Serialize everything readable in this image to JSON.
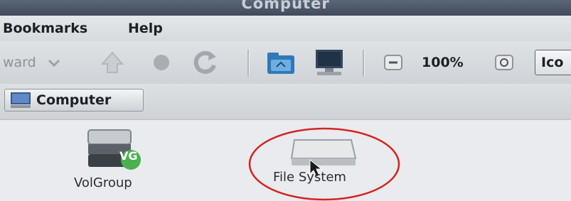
{
  "window": {
    "title": "Computer"
  },
  "menu": {
    "bookmarks": "Bookmarks",
    "help": "Help"
  },
  "toolbar": {
    "forward_label": "ward",
    "zoom_level": "100%",
    "view_mode": "Ico"
  },
  "location": {
    "crumb": "Computer"
  },
  "content": {
    "items": [
      {
        "label": "VolGroup",
        "badge": "VG"
      },
      {
        "label": "File System"
      }
    ]
  }
}
